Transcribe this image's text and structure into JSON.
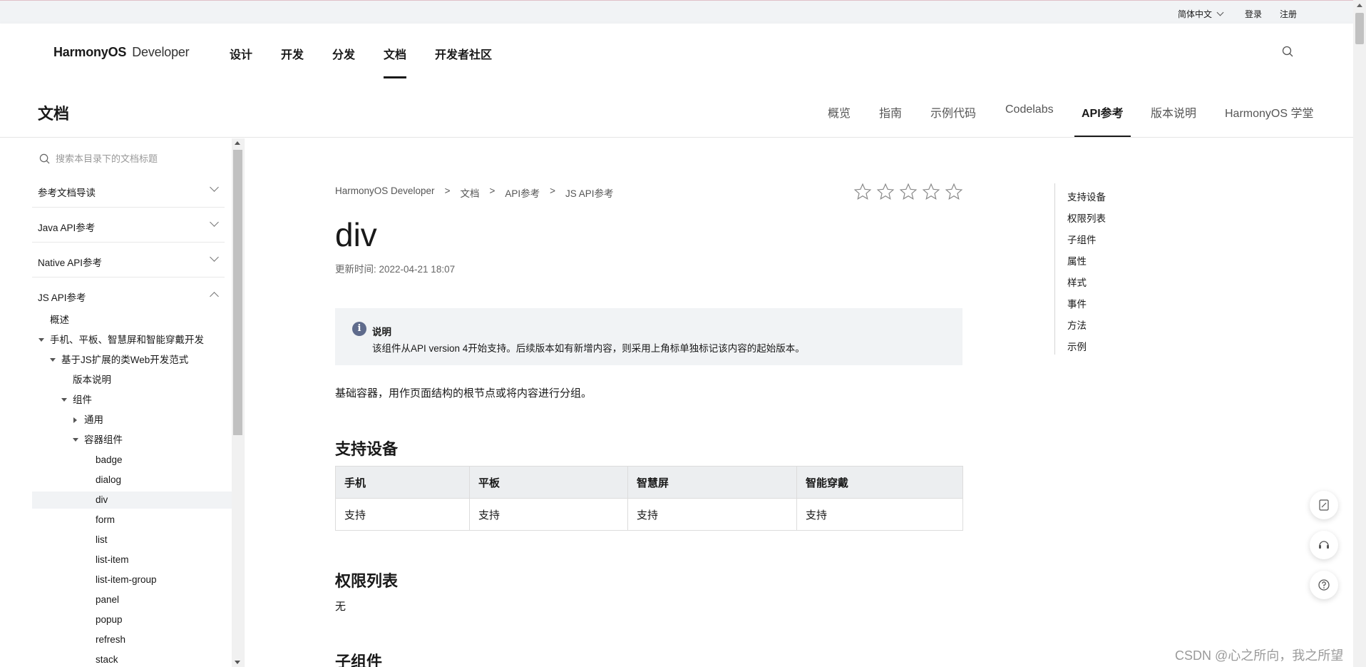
{
  "utilbar": {
    "lang": "简体中文",
    "login": "登录",
    "register": "注册"
  },
  "header": {
    "logo_brand": "HarmonyOS",
    "logo_sub": "Developer",
    "nav": [
      "设计",
      "开发",
      "分发",
      "文档",
      "开发者社区"
    ],
    "active_nav": "文档"
  },
  "subheader": {
    "title": "文档",
    "tabs": [
      "概览",
      "指南",
      "示例代码",
      "Codelabs",
      "API参考",
      "版本说明",
      "HarmonyOS 学堂"
    ],
    "active_tab": "API参考"
  },
  "sidebar": {
    "search_placeholder": "搜索本目录下的文档标题",
    "sections": [
      "参考文档导读",
      "Java API参考",
      "Native API参考",
      "JS API参考"
    ],
    "tree": [
      "概述",
      "手机、平板、智慧屏和智能穿戴开发",
      "基于JS扩展的类Web开发范式",
      "版本说明",
      "组件",
      "通用",
      "容器组件",
      "badge",
      "dialog",
      "div",
      "form",
      "list",
      "list-item",
      "list-item-group",
      "panel",
      "popup",
      "refresh",
      "stack"
    ],
    "selected": "div"
  },
  "content": {
    "breadcrumb": [
      "HarmonyOS Developer",
      "文档",
      "API参考",
      "JS API参考"
    ],
    "breadcrumb_sep": ">",
    "title": "div",
    "updated": "更新时间: 2022-04-21 18:07",
    "note_title": "说明",
    "note_body": "该组件从API version 4开始支持。后续版本如有新增内容，则采用上角标单独标记该内容的起始版本。",
    "intro": "基础容器，用作页面结构的根节点或将内容进行分组。",
    "h_devices": "支持设备",
    "device_headers": [
      "手机",
      "平板",
      "智慧屏",
      "智能穿戴"
    ],
    "device_values": [
      "支持",
      "支持",
      "支持",
      "支持"
    ],
    "h_permissions": "权限列表",
    "permissions": "无",
    "h_children": "子组件"
  },
  "toc": [
    "支持设备",
    "权限列表",
    "子组件",
    "属性",
    "样式",
    "事件",
    "方法",
    "示例"
  ],
  "watermark": "CSDN @心之所向，我之所望"
}
